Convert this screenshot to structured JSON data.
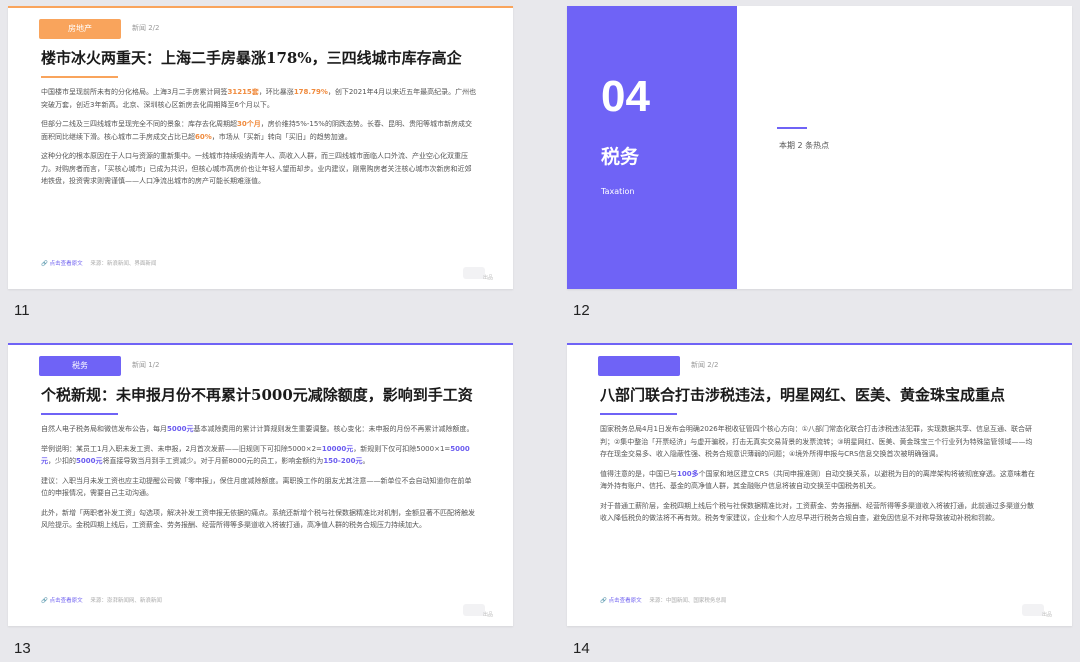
{
  "slides": [
    {
      "number": "11",
      "tag": "房地产",
      "news_no": "新闻 2/2",
      "title": "楼市冰火两重天：上海二手房暴涨178%，三四线城市库存高企",
      "paragraphs": [
        [
          {
            "t": "中国楼市呈现前所未有的分化格局。上海3月二手房累计网签"
          },
          {
            "t": "31215套",
            "h": "o"
          },
          {
            "t": "，环比暴涨"
          },
          {
            "t": "178.79%",
            "h": "o"
          },
          {
            "t": "，创下2021年4月以来近五年最高纪录。广州也突破万套，创近3年新高。北京、深圳核心区新房去化周期降至6个月以下。"
          }
        ],
        [
          {
            "t": "但部分二线及三四线城市呈现完全不同的景象：库存去化周期超"
          },
          {
            "t": "30个月",
            "h": "o"
          },
          {
            "t": "，房价维持5%-15%的阴跌态势。长春、昆明、贵阳等城市新房成交面积同比继续下滑。核心城市二手房成交占比已超"
          },
          {
            "t": "60%",
            "h": "o"
          },
          {
            "t": "，市场从「买新」转向「买旧」的趋势加速。"
          }
        ],
        [
          {
            "t": "这种分化的根本原因在于人口与资源的重新集中。一线城市持续吸纳青年人、高收入人群，而三四线城市面临人口外流、产业空心化双重压力。对购房者而言，「买核心城市」已成为共识，但核心城市高房价也让年轻人望而却步。业内建议，刚需购房者关注核心城市次新房和近郊地铁盘，投资需求则需谨慎——人口净流出城市的房产可能长期难涨值。"
          }
        ]
      ],
      "footer_link": "点击查看原文",
      "footer_source": "来源：新浪新闻、界面新闻",
      "corner_text": "出品"
    },
    {
      "number": "12",
      "section_number": "04",
      "section_title": "税务",
      "section_en": "Taxation",
      "section_sub": "本期 2 条热点"
    },
    {
      "number": "13",
      "tag": "税务",
      "news_no": "新闻 1/2",
      "title": "个税新规：未申报月份不再累计5000元减除额度，影响到手工资",
      "paragraphs": [
        [
          {
            "t": "自然人电子税务局和微信发布公告，每月"
          },
          {
            "t": "5000元",
            "h": "b"
          },
          {
            "t": "基本减除费用的累计计算规则发生重要调整。核心变化：未申报的月份不再累计减除额度。"
          }
        ],
        [
          {
            "t": "举例说明：某员工1月入职未发工资、未申报，2月首次发薪——旧规则下可扣除5000×2="
          },
          {
            "t": "10000元",
            "h": "b"
          },
          {
            "t": "，新规则下仅可扣除5000×1="
          },
          {
            "t": "5000元",
            "h": "b"
          },
          {
            "t": "，少扣的"
          },
          {
            "t": "5000元",
            "h": "b"
          },
          {
            "t": "将直接导致当月到手工资减少。对于月薪8000元的员工，影响金额约为"
          },
          {
            "t": "150-200元",
            "h": "b"
          },
          {
            "t": "。"
          }
        ],
        [
          {
            "t": "建议：入职当月未发工资也应主动提醒公司做「零申报」，保住月度减除额度。离职换工作的朋友尤其注意——新单位不会自动知道你在前单位的申报情况，需要自己主动沟通。"
          }
        ],
        [
          {
            "t": "此外，新增「两职者补发工资」勾选项，解决补发工资申报无依据的痛点。系统还新增个税与社保数据精准比对机制，金额显著不匹配将触发风险提示。金税四期上线后，工资薪金、劳务报酬、经营所得等多渠道收入将被打通，高净值人群的税务合规压力持续加大。"
          }
        ]
      ],
      "footer_link": "点击查看原文",
      "footer_source": "来源：澎湃新闻网、新浪新闻",
      "corner_text": "出品"
    },
    {
      "number": "14",
      "tag": "",
      "news_no": "新闻 2/2",
      "title": "八部门联合打击涉税违法，明星网红、医美、黄金珠宝成重点",
      "paragraphs": [
        [
          {
            "t": "国家税务总局4月1日发布会明确2026年税收征管四个核心方向：①八部门常态化联合打击涉税违法犯罪，实现数据共享、信息互通、联合研判；②集中整治「开票经济」与虚开骗税，打击无真实交易背景的发票流转；③明星网红、医美、黄金珠宝三个行业列为特殊监管领域——均存在现金交易多、收入隐蔽性强、税务合规意识薄弱的问题；④境外所得申报与CRS信息交换首次被明确强调。"
          }
        ],
        [
          {
            "t": "值得注意的是，中国已与"
          },
          {
            "t": "100多",
            "h": "b"
          },
          {
            "t": "个国家和地区建立CRS（共同申报准则）自动交换关系，以避税为目的的离岸架构将被彻底穿透。这意味着在海外持有账户、信托、基金的高净值人群，其金融账户信息将被自动交换至中国税务机关。"
          }
        ],
        [
          {
            "t": "对于普通工薪阶层，金税四期上线后个税与社保数据精准比对，工资薪金、劳务报酬、经营所得等多渠道收入将被打通，此前通过多渠道分散收入降低税负的做法将不再有效。税务专家建议，企业和个人应尽早进行税务合规自查，避免因信息不对称导致被动补税和罚款。"
          }
        ]
      ],
      "footer_link": "点击查看原文",
      "footer_source": "来源：中国新闻、国家税务总局",
      "corner_text": "出品"
    }
  ],
  "colors": {
    "orange_accent": "#f9a45c",
    "purple_accent": "#6f63f6",
    "highlight_orange": "#f08a3c",
    "highlight_purple": "#6b5cf0"
  }
}
